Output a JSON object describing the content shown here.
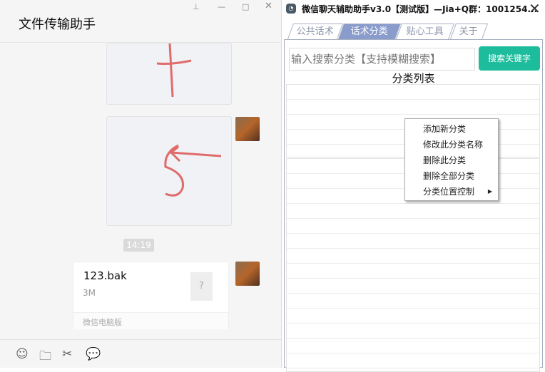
{
  "chat": {
    "title": "文件传输助手",
    "time": "14:19",
    "file": {
      "name": "123.bak",
      "size": "3M",
      "icon": "?",
      "source": "微信电脑版"
    },
    "window_controls": [
      "pin-icon",
      "minimize-icon",
      "maximize-icon",
      "close-icon"
    ],
    "toolbar": [
      "emoji-icon",
      "folder-icon",
      "scissors-icon",
      "chat-bubble-icon"
    ]
  },
  "helper": {
    "title": "微信聊天辅助助手v3.0【测试版】—Jia+Q群：1001254...",
    "tabs": [
      {
        "label": "公共话术"
      },
      {
        "label": "话术分类"
      },
      {
        "label": "贴心工具"
      },
      {
        "label": "关于"
      }
    ],
    "search_placeholder": "输入搜索分类【支持模糊搜索】",
    "search_button": "搜索关键字",
    "list_title": "分类列表",
    "context_menu": [
      "添加新分类",
      "修改此分类名称",
      "删除此分类",
      "删除全部分类",
      "分类位置控制"
    ]
  }
}
